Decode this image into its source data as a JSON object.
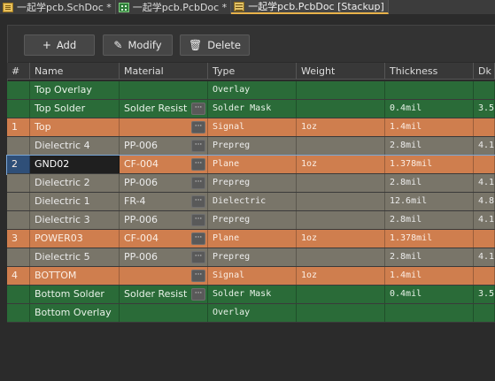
{
  "tabs": [
    {
      "label": "一起学pcb.SchDoc *",
      "icon": "schematic-doc-icon"
    },
    {
      "label": "一起学pcb.PcbDoc *",
      "icon": "pcb-doc-icon"
    },
    {
      "label": "一起学pcb.PcbDoc [Stackup]",
      "icon": "stackup-doc-icon"
    }
  ],
  "toolbar": {
    "add_icon": "+",
    "add_label": "Add",
    "modify_icon": "✎",
    "modify_label": "Modify",
    "delete_icon": "🗑",
    "delete_label": "Delete"
  },
  "columns": [
    "#",
    "Name",
    "Material",
    "Type",
    "Weight",
    "Thickness",
    "Dk"
  ],
  "ellipsis": "···",
  "layers": [
    {
      "num": "",
      "name": "Top Overlay",
      "material": "",
      "type": "Overlay",
      "weight": "",
      "thickness": "",
      "dk": "",
      "kind": "overlay"
    },
    {
      "num": "",
      "name": "Top Solder",
      "material": "Solder Resist",
      "type": "Solder Mask",
      "weight": "",
      "thickness": "0.4mil",
      "dk": "3.5",
      "kind": "mask"
    },
    {
      "num": "1",
      "name": "Top",
      "material": "",
      "type": "Signal",
      "weight": "1oz",
      "thickness": "1.4mil",
      "dk": "",
      "kind": "signal"
    },
    {
      "num": "",
      "name": "Dielectric 4",
      "material": "PP-006",
      "type": "Prepreg",
      "weight": "",
      "thickness": "2.8mil",
      "dk": "4.1",
      "kind": "diel"
    },
    {
      "num": "2",
      "name": "GND02",
      "material": "CF-004",
      "type": "Plane",
      "weight": "1oz",
      "thickness": "1.378mil",
      "dk": "",
      "kind": "plane"
    },
    {
      "num": "",
      "name": "Dielectric 2",
      "material": "PP-006",
      "type": "Prepreg",
      "weight": "",
      "thickness": "2.8mil",
      "dk": "4.1",
      "kind": "diel"
    },
    {
      "num": "",
      "name": "Dielectric 1",
      "material": "FR-4",
      "type": "Dielectric",
      "weight": "",
      "thickness": "12.6mil",
      "dk": "4.8",
      "kind": "diel"
    },
    {
      "num": "",
      "name": "Dielectric 3",
      "material": "PP-006",
      "type": "Prepreg",
      "weight": "",
      "thickness": "2.8mil",
      "dk": "4.1",
      "kind": "diel"
    },
    {
      "num": "3",
      "name": "POWER03",
      "material": "CF-004",
      "type": "Plane",
      "weight": "1oz",
      "thickness": "1.378mil",
      "dk": "",
      "kind": "plane"
    },
    {
      "num": "",
      "name": "Dielectric 5",
      "material": "PP-006",
      "type": "Prepreg",
      "weight": "",
      "thickness": "2.8mil",
      "dk": "4.1",
      "kind": "diel"
    },
    {
      "num": "4",
      "name": "BOTTOM",
      "material": "",
      "type": "Signal",
      "weight": "1oz",
      "thickness": "1.4mil",
      "dk": "",
      "kind": "signal"
    },
    {
      "num": "",
      "name": "Bottom Solder",
      "material": "Solder Resist",
      "type": "Solder Mask",
      "weight": "",
      "thickness": "0.4mil",
      "dk": "3.5",
      "kind": "mask"
    },
    {
      "num": "",
      "name": "Bottom Overlay",
      "material": "",
      "type": "Overlay",
      "weight": "",
      "thickness": "",
      "dk": "",
      "kind": "overlay"
    }
  ],
  "selected_row": 4,
  "colors": {
    "overlay": "#2a6b38",
    "copper": "#cf7e4e",
    "dielectric": "#797569",
    "active_tab_accent": "#e8b34a"
  }
}
